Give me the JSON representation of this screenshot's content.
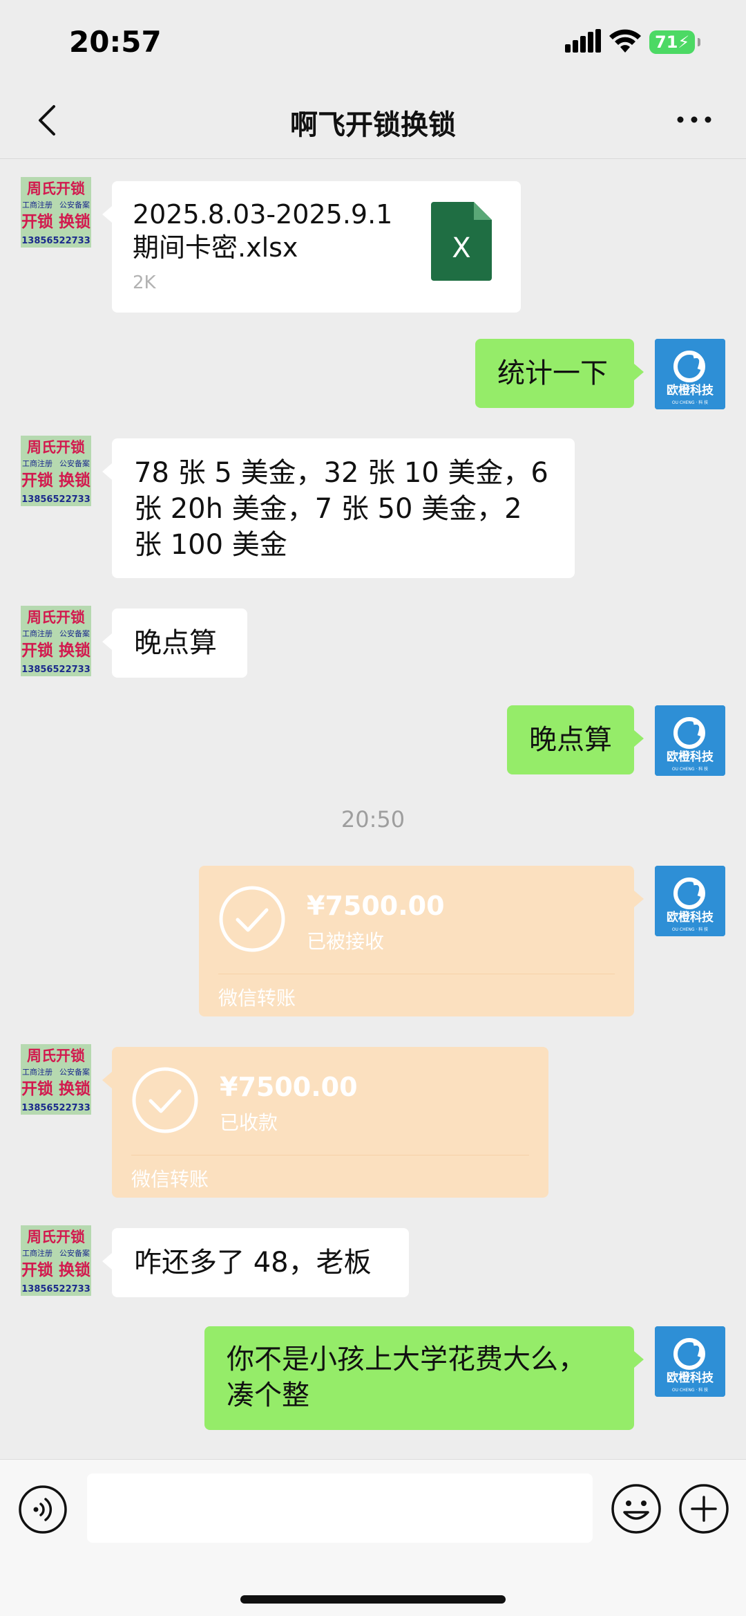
{
  "status_bar": {
    "time": "20:57",
    "battery": "71"
  },
  "nav": {
    "title": "啊飞开锁换锁"
  },
  "contact_avatar": {
    "line1": "周氏开锁",
    "line2a": "工商注册",
    "line2b": "公安备案",
    "line3": "开锁 换锁",
    "line4": "13856522733"
  },
  "my_avatar": {
    "brand": "欧橙科技",
    "sub": "OU CHENG · 科 技"
  },
  "messages": {
    "file": {
      "name_line1": "2025.8.03-2025.9.1",
      "name_line2": "期间卡密.xlsx",
      "size": "2K",
      "icon_letter": "X"
    },
    "m2": "统计一下",
    "m3": "78 张 5 美金，32 张 10 美金，6 张 20h 美金，7 张 50 美金，2 张 100 美金",
    "m4": "晚点算",
    "m5": "晚点算",
    "timestamp": "20:50",
    "transfer_out": {
      "amount": "¥7500.00",
      "status": "已被接收",
      "source": "微信转账"
    },
    "transfer_in": {
      "amount": "¥7500.00",
      "status": "已收款",
      "source": "微信转账"
    },
    "m8": "咋还多了 48，老板",
    "m9": "你不是小孩上大学花费大么，凑个整"
  },
  "input": {
    "placeholder": ""
  },
  "colors": {
    "bg": "#ededed",
    "green_bubble": "#95ec69",
    "white_bubble": "#ffffff",
    "transfer": "#fbe0bf",
    "excel": "#1f6e43",
    "battery": "#4cd964"
  }
}
